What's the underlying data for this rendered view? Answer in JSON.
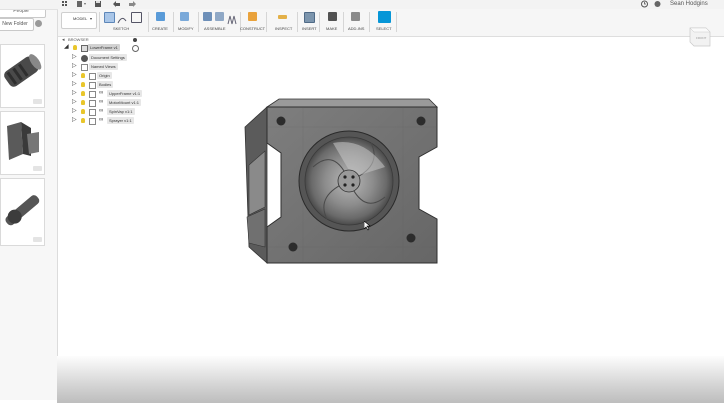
{
  "topbar": {
    "user_name": "Sean Hodgins",
    "help_icon": "question-circle-icon",
    "clock_icon": "clock-icon",
    "apps_icon": "grid-icon",
    "file_icon": "file-icon",
    "save_icon": "save-icon",
    "undo_icon": "undo-icon",
    "redo_icon": "redo-icon"
  },
  "data_panel": {
    "people_label": "People",
    "new_folder_label": "New Folder",
    "thumbnails": [
      {
        "label": "",
        "version": ""
      },
      {
        "label": "",
        "version": ""
      },
      {
        "label": "",
        "version": ""
      }
    ]
  },
  "toolbar": {
    "workspace": "MODEL",
    "groups": [
      {
        "label": "SKETCH",
        "icon": "sketch-icon"
      },
      {
        "label": "CREATE",
        "icon": "create-box-icon"
      },
      {
        "label": "MODIFY",
        "icon": "modify-icon"
      },
      {
        "label": "ASSEMBLE",
        "icon": "assemble-icon"
      },
      {
        "label": "CONSTRUCT",
        "icon": "construct-plane-icon"
      },
      {
        "label": "INSPECT",
        "icon": "inspect-measure-icon"
      },
      {
        "label": "INSERT",
        "icon": "insert-image-icon"
      },
      {
        "label": "MAKE",
        "icon": "make-3d-print-icon"
      },
      {
        "label": "ADD-INS",
        "icon": "add-ins-icon"
      },
      {
        "label": "SELECT",
        "icon": "select-cursor-icon"
      }
    ]
  },
  "browser": {
    "title": "BROWSER",
    "root": "LowerFrame v1",
    "items": [
      {
        "label": "Document Settings",
        "icon": "gear-icon",
        "bulb": false
      },
      {
        "label": "Named Views",
        "icon": "folder-icon",
        "bulb": false
      },
      {
        "label": "Origin",
        "icon": "folder-icon",
        "bulb": true
      },
      {
        "label": "Bodies",
        "icon": "folder-icon",
        "bulb": true
      },
      {
        "label": "UpperFrame v1:1",
        "icon": "link-icon",
        "bulb": true
      },
      {
        "label": "MotorMount v1:1",
        "icon": "link-icon",
        "bulb": true
      },
      {
        "label": "SpinVap v1:1",
        "icon": "link-icon",
        "bulb": true
      },
      {
        "label": "Sprayer v1:1",
        "icon": "link-icon",
        "bulb": true
      }
    ]
  },
  "viewcube": {
    "face": "FRONT"
  },
  "colors": {
    "accent": "#0696d7",
    "model_body": "#6e6e6e",
    "background": "#ffffff"
  }
}
